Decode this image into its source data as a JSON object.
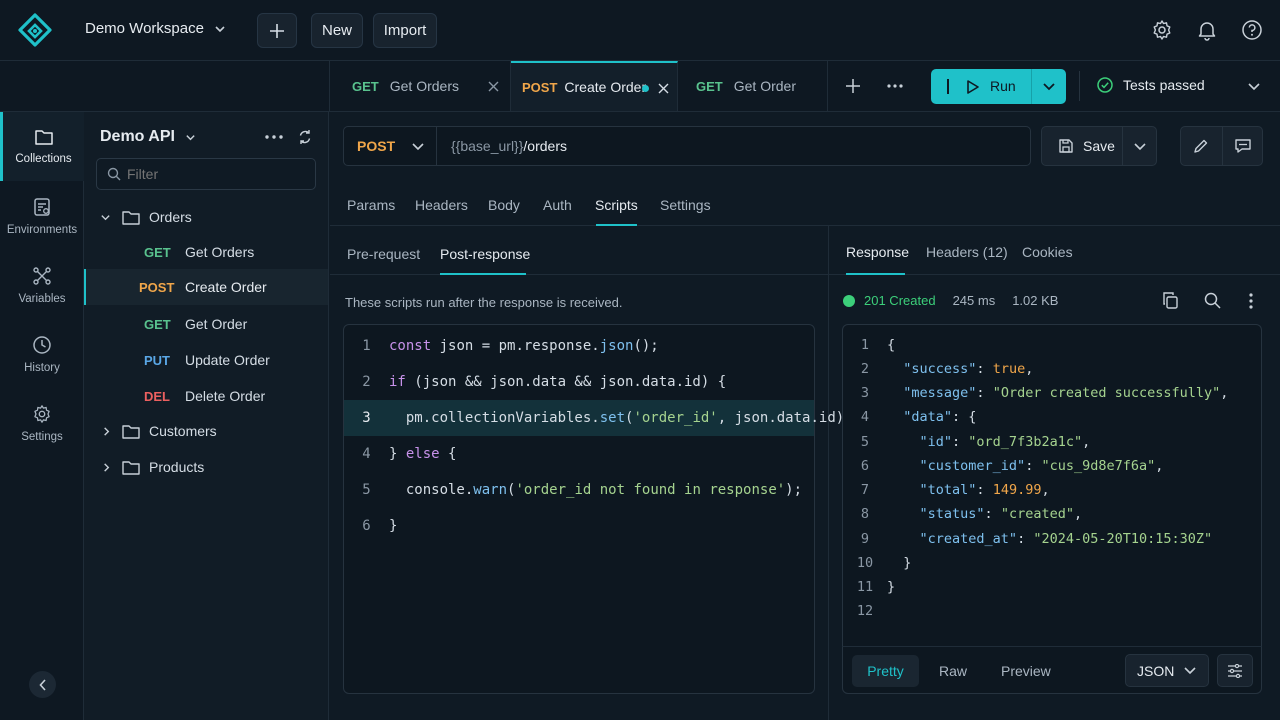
{
  "workspace": {
    "name": "Demo Workspace"
  },
  "topbar": {
    "new_label": "New",
    "import_label": "Import"
  },
  "tabs": [
    {
      "method": "GET",
      "name": "Get Orders"
    },
    {
      "method": "POST",
      "name": "Create Order"
    },
    {
      "method": "GET",
      "name": "Get Order"
    }
  ],
  "run": {
    "label": "Run"
  },
  "tests": {
    "label": "Tests passed"
  },
  "rail": {
    "items": [
      {
        "label": "Collections"
      },
      {
        "label": "Environments"
      },
      {
        "label": "Variables"
      },
      {
        "label": "History"
      },
      {
        "label": "Settings"
      }
    ]
  },
  "sidebar": {
    "title": "Demo API",
    "filter_placeholder": "Filter",
    "folders": [
      "Orders",
      "Customers",
      "Products"
    ],
    "requests": [
      {
        "method": "GET",
        "name": "Get Orders"
      },
      {
        "method": "POST",
        "name": "Create Order"
      },
      {
        "method": "GET",
        "name": "Get Order"
      },
      {
        "method": "PUT",
        "name": "Update Order"
      },
      {
        "method": "DEL",
        "name": "Delete Order"
      }
    ]
  },
  "request": {
    "method": "POST",
    "url_var": "{{base_url}}",
    "url_path": "/orders",
    "save_label": "Save"
  },
  "req_tabs": [
    "Params",
    "Headers",
    "Body",
    "Auth",
    "Scripts",
    "Settings"
  ],
  "script_tabs": [
    "Pre-request",
    "Post-response"
  ],
  "script_hint": "These scripts run after the response is received.",
  "script_code": {
    "l1": {
      "kw": "const",
      "a": " json = pm.response.",
      "fn": "json",
      "b": "();"
    },
    "l2": {
      "kw": "if",
      "a": " (json && json.data && json.data.id) {"
    },
    "l3": {
      "a": "  pm.collectionVariables.",
      "fn": "set",
      "b": "(",
      "str": "'order_id'",
      "c": ", json.data.id);"
    },
    "l4": {
      "a": "} ",
      "kw": "else",
      "b": " {"
    },
    "l5": {
      "a": "  console.",
      "fn": "warn",
      "b": "(",
      "str": "'order_id not found in response'",
      "c": ");"
    },
    "l6": {
      "a": "}"
    }
  },
  "response": {
    "tabs": [
      "Response",
      "Headers (12)",
      "Cookies"
    ],
    "status": "201 Created",
    "time": "245 ms",
    "size": "1.02 KB",
    "body": {
      "success": "true",
      "message": "\"Order created successfully\"",
      "id": "\"ord_7f3b2a1c\"",
      "customer_id": "\"cus_9d8e7f6a\"",
      "total": "149.99",
      "status": "\"created\"",
      "created_at": "\"2024-05-20T10:15:30Z\""
    },
    "view_tabs": [
      "Pretty",
      "Raw",
      "Preview"
    ],
    "format": "JSON"
  },
  "colors": {
    "accent": "#1fc1c9",
    "success": "#3ccf7a"
  }
}
